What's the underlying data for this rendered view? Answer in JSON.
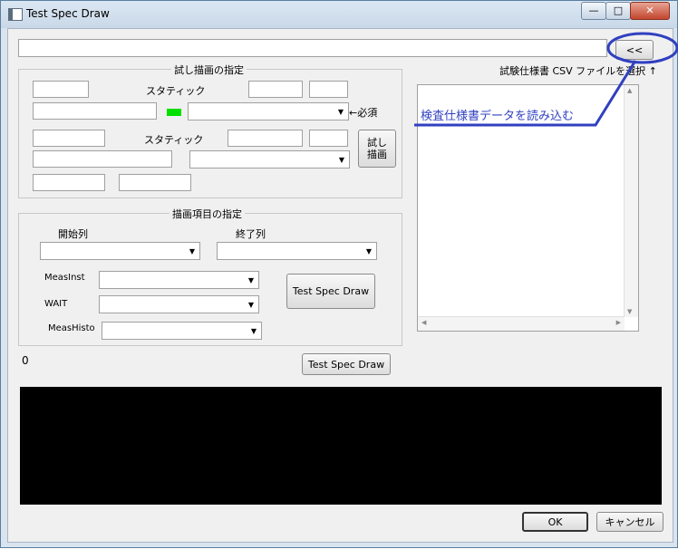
{
  "window": {
    "title": "Test Spec Draw",
    "minimize": "—",
    "maximize": "□",
    "close": "✕"
  },
  "top": {
    "path_value": "",
    "browse_button": "<<"
  },
  "trial": {
    "group_title": "試し描画の指定",
    "static_label_1": "スタティック",
    "static_label_2": "スタティック",
    "required_label": "←必須",
    "trial_button": "試し\n描画"
  },
  "items": {
    "group_title": "描画項目の指定",
    "start_col_label": "開始列",
    "end_col_label": "終了列",
    "measinst_label": "MeasInst",
    "wait_label": "WAIT",
    "meashisto_label": "MeasHisto",
    "test_spec_draw_button": "Test Spec Draw"
  },
  "right": {
    "csv_label": "試験仕様書 CSV ファイルを選択 ↑",
    "annotation": "検査仕様書データを読み込む"
  },
  "bottom": {
    "counter": "0",
    "test_spec_draw_button": "Test Spec Draw",
    "ok_button": "OK",
    "cancel_button": "キャンセル"
  },
  "colors": {
    "indicator": "#00e000",
    "annotation": "#3040c0",
    "console": "#000000"
  }
}
